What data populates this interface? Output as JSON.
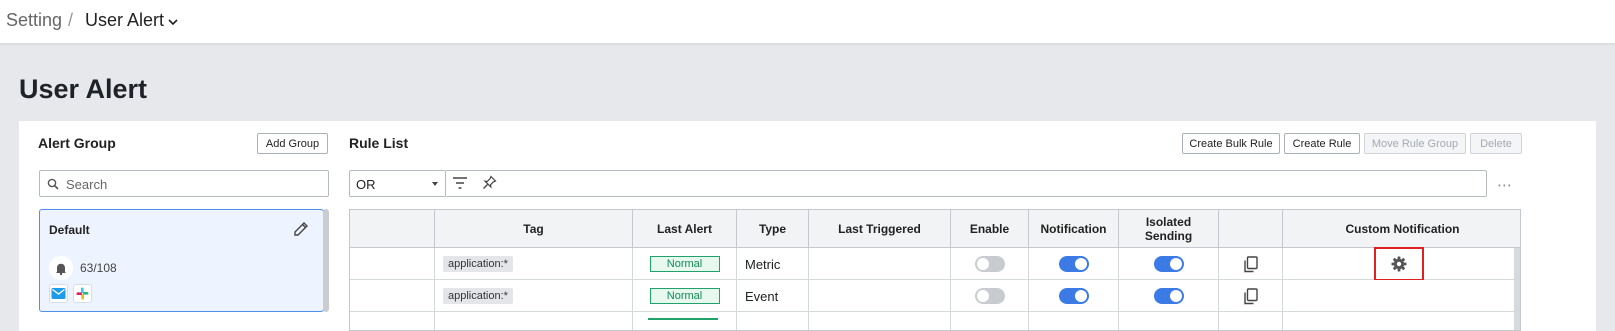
{
  "breadcrumb": {
    "root": "Setting",
    "separator": "/",
    "current": "User Alert"
  },
  "page_title": "User Alert",
  "alert_group": {
    "title": "Alert Group",
    "add_button": "Add Group",
    "search_placeholder": "Search",
    "groups": [
      {
        "name": "Default",
        "count": "63/108",
        "channels": [
          "email-icon",
          "slack-icon"
        ]
      }
    ]
  },
  "rule_list": {
    "title": "Rule List",
    "buttons": {
      "create_bulk": "Create Bulk Rule",
      "create_rule": "Create Rule",
      "move_group": "Move Rule Group",
      "delete": "Delete"
    },
    "filter_operator": "OR",
    "columns": [
      "",
      "Tag",
      "Last Alert",
      "Type",
      "Last Triggered",
      "Enable",
      "Notification",
      "Isolated Sending",
      "",
      "Custom Notification"
    ],
    "rows": [
      {
        "tag": "application:*",
        "last_alert": "Normal",
        "type": "Metric",
        "last_triggered": "",
        "enable": false,
        "notification": true,
        "isolated_sending": true,
        "custom_notification_icon": "gear-icon"
      },
      {
        "tag": "application:*",
        "last_alert": "Normal",
        "type": "Event",
        "last_triggered": "",
        "enable": false,
        "notification": true,
        "isolated_sending": true,
        "custom_notification_icon": ""
      }
    ]
  },
  "colors": {
    "accent": "#3c7ae6",
    "normal_status": "#1fa36b",
    "highlight": "#e02020"
  }
}
